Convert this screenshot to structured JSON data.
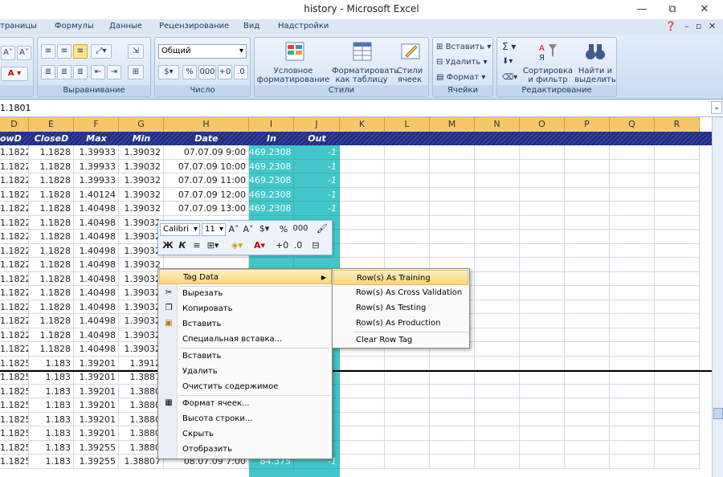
{
  "window": {
    "title": "history - Microsoft Excel",
    "minimize": "—",
    "restore": "⧉",
    "close": "✕"
  },
  "tabs": [
    "траницы",
    "Формулы",
    "Данные",
    "Рецензирование",
    "Вид",
    "Надстройки"
  ],
  "ribbon": {
    "groups": {
      "alignment": "Выравнивание",
      "number": "Число",
      "styles": "Стили",
      "cells": "Ячейки",
      "editing": "Редактирование"
    },
    "number_format": "Общий",
    "cond_format": [
      "Условное",
      "форматирование"
    ],
    "format_table": [
      "Форматировать",
      "как таблицу"
    ],
    "cell_styles": [
      "Стили",
      "ячеек"
    ],
    "insert": "Вставить",
    "delete": "Удалить",
    "format": "Формат",
    "sort": [
      "Сортировка",
      "и фильтр"
    ],
    "find": [
      "Найти и",
      "выделить"
    ],
    "percent": "%",
    "thousands": "000"
  },
  "formula_bar": {
    "value": "1.1801"
  },
  "columns": [
    "D",
    "E",
    "F",
    "G",
    "H",
    "I",
    "J",
    "K",
    "L",
    "M",
    "N",
    "O",
    "P",
    "Q",
    "R"
  ],
  "headers": [
    "owD",
    "CloseD",
    "Max",
    "Min",
    "Date",
    "In",
    "Out"
  ],
  "rows": [
    [
      "1.18224",
      "1.1828",
      "1.39933",
      "1.39032",
      "07.07.09 9:00",
      "469.2308",
      "-1"
    ],
    [
      "1.18224",
      "1.1828",
      "1.39933",
      "1.39032",
      "07.07.09 10:00",
      "469.2308",
      "-1"
    ],
    [
      "1.18224",
      "1.1828",
      "1.39933",
      "1.39032",
      "07.07.09 11:00",
      "469.2308",
      "-1"
    ],
    [
      "1.18224",
      "1.1828",
      "1.40124",
      "1.39032",
      "07.07.09 12:00",
      "469.2308",
      "-1"
    ],
    [
      "1.18224",
      "1.1828",
      "1.40498",
      "1.39032",
      "07.07.09 13:00",
      "469.2308",
      "-1"
    ],
    [
      "1.18224",
      "1.1828",
      "1.40498",
      "1.39032",
      "",
      "",
      ""
    ],
    [
      "1.18224",
      "1.1828",
      "1.40498",
      "1.39032",
      "",
      "",
      ""
    ],
    [
      "1.18224",
      "1.1828",
      "1.40498",
      "1.39032",
      "",
      "",
      ""
    ],
    [
      "1.18224",
      "1.1828",
      "1.40498",
      "1.39032",
      "",
      "",
      ""
    ],
    [
      "1.18224",
      "1.1828",
      "1.40498",
      "1.39032",
      "",
      "",
      ""
    ],
    [
      "1.18224",
      "1.1828",
      "1.40498",
      "1.39032",
      "",
      "",
      ""
    ],
    [
      "1.18224",
      "1.1828",
      "1.40498",
      "1.39032",
      "",
      "",
      ""
    ],
    [
      "1.18224",
      "1.1828",
      "1.40498",
      "1.39032",
      "",
      "",
      ""
    ],
    [
      "1.18224",
      "1.1828",
      "1.40498",
      "1.39032",
      "",
      "",
      ""
    ],
    [
      "1.18224",
      "1.1828",
      "1.40498",
      "1.39032",
      "",
      "",
      ""
    ],
    [
      "1.1825",
      "1.183",
      "1.39201",
      "1.3912",
      "",
      "",
      ""
    ],
    [
      "1.1825",
      "1.183",
      "1.39201",
      "1.3887",
      "",
      "",
      ""
    ],
    [
      "1.1825",
      "1.183",
      "1.39201",
      "1.3880",
      "",
      "",
      ""
    ],
    [
      "1.1825",
      "1.183",
      "1.39201",
      "1.3880",
      "",
      "",
      ""
    ],
    [
      "1.1825",
      "1.183",
      "1.39201",
      "1.3880",
      "",
      "",
      ""
    ],
    [
      "1.1825",
      "1.183",
      "1.39201",
      "1.3880",
      "",
      "",
      ""
    ],
    [
      "1.1825",
      "1.183",
      "1.39255",
      "1.3880",
      "",
      "",
      ""
    ],
    [
      "1.1825",
      "1.183",
      "1.39255",
      "1.38807",
      "08.07.09 7:00",
      "84.375",
      "-1"
    ]
  ],
  "mini_toolbar": {
    "font": "Calibri",
    "size": "11",
    "bold": "Ж",
    "italic": "К",
    "percent": "%",
    "thousands": "000"
  },
  "context_menu": [
    {
      "label": "Tag Data",
      "submenu": true
    },
    {
      "label": "Вырезать",
      "icon": "scissors-icon"
    },
    {
      "label": "Копировать",
      "icon": "copy-icon"
    },
    {
      "label": "Вставить",
      "icon": "paste-icon"
    },
    {
      "label": "Специальная вставка..."
    },
    {
      "label": "Вставить"
    },
    {
      "label": "Удалить"
    },
    {
      "label": "Очистить содержимое"
    },
    {
      "label": "Формат ячеек...",
      "icon": "format-cells-icon"
    },
    {
      "label": "Высота строки..."
    },
    {
      "label": "Скрыть"
    },
    {
      "label": "Отобразить"
    }
  ],
  "submenu": [
    "Row(s) As Training",
    "Row(s) As Cross Validation",
    "Row(s) As Testing",
    "Row(s) As Production",
    "Clear Row Tag"
  ],
  "colors": {
    "column_header": "#f7c66b",
    "header_row": "#1e2a7a",
    "teal": "#43c6c9",
    "highlight": "#fbd67a"
  }
}
